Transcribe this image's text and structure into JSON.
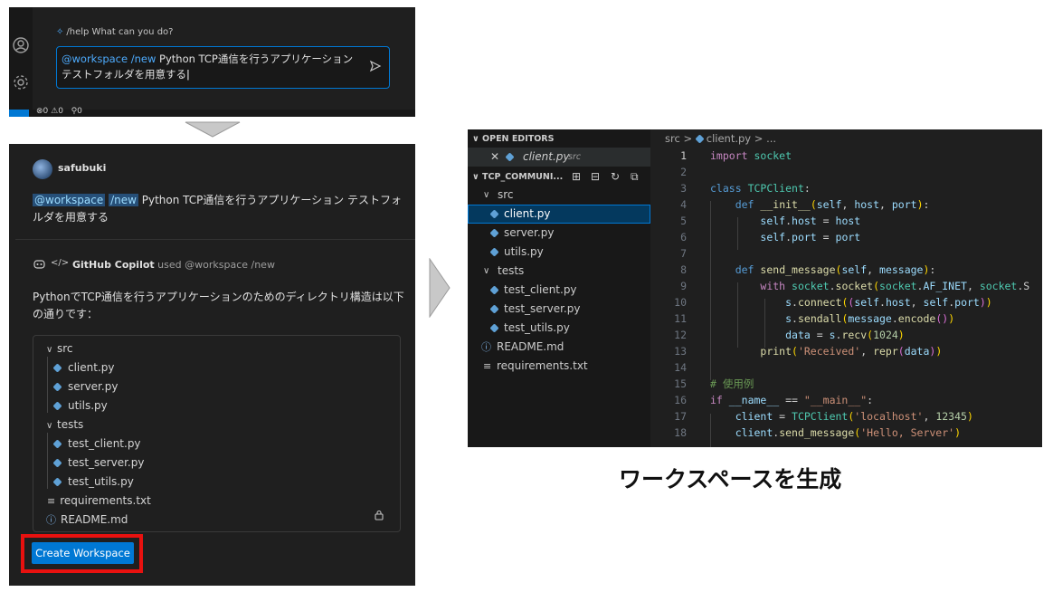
{
  "top_chat": {
    "help_hint": "/help What can you do?",
    "prompt_tag": "@workspace /new",
    "prompt_text": " Python TCP通信を行うアプリケーション テストフォルダを用意する",
    "status": {
      "errors": "0",
      "warnings": "0",
      "ports": "0"
    }
  },
  "chat": {
    "user_name": "safubuki",
    "user_chip1": "@workspace",
    "user_chip2": "/new",
    "user_text": " Python TCP通信を行うアプリケーション テストフォルダを用意する",
    "copilot_name": "GitHub Copilot",
    "copilot_used": "used @workspace /new",
    "answer": "PythonでTCP通信を行うアプリケーションのためのディレクトリ構造は以下の通りです：",
    "tree": [
      {
        "type": "folder",
        "label": "src"
      },
      {
        "type": "py",
        "label": "client.py"
      },
      {
        "type": "py",
        "label": "server.py"
      },
      {
        "type": "py",
        "label": "utils.py"
      },
      {
        "type": "folder",
        "label": "tests"
      },
      {
        "type": "py",
        "label": "test_client.py"
      },
      {
        "type": "py",
        "label": "test_server.py"
      },
      {
        "type": "py",
        "label": "test_utils.py"
      },
      {
        "type": "txt",
        "label": "requirements.txt"
      },
      {
        "type": "info",
        "label": "README.md"
      }
    ],
    "create_button": "Create Workspace"
  },
  "explorer": {
    "open_editors_header": "OPEN EDITORS",
    "open_file": "client.py",
    "open_file_dir": "src",
    "project_header": "TCP_COMMUNI...",
    "items": [
      {
        "type": "folder",
        "label": "src"
      },
      {
        "type": "py",
        "label": "client.py"
      },
      {
        "type": "py",
        "label": "server.py"
      },
      {
        "type": "py",
        "label": "utils.py"
      },
      {
        "type": "folder",
        "label": "tests"
      },
      {
        "type": "py",
        "label": "test_client.py"
      },
      {
        "type": "py",
        "label": "test_server.py"
      },
      {
        "type": "py",
        "label": "test_utils.py"
      },
      {
        "type": "info",
        "label": "README.md"
      },
      {
        "type": "txt",
        "label": "requirements.txt"
      }
    ]
  },
  "editor": {
    "breadcrumb_src": "src",
    "breadcrumb_file": "client.py",
    "breadcrumb_more": "...",
    "line_numbers": [
      "1",
      "2",
      "3",
      "4",
      "5",
      "6",
      "7",
      "8",
      "9",
      "10",
      "11",
      "12",
      "13",
      "14",
      "15",
      "16",
      "17",
      "18"
    ]
  },
  "caption": "ワークスペースを生成",
  "colors": {
    "accent": "#0078d4",
    "highlight_frame": "#e8110f",
    "panel_bg": "#1f1f1f"
  }
}
